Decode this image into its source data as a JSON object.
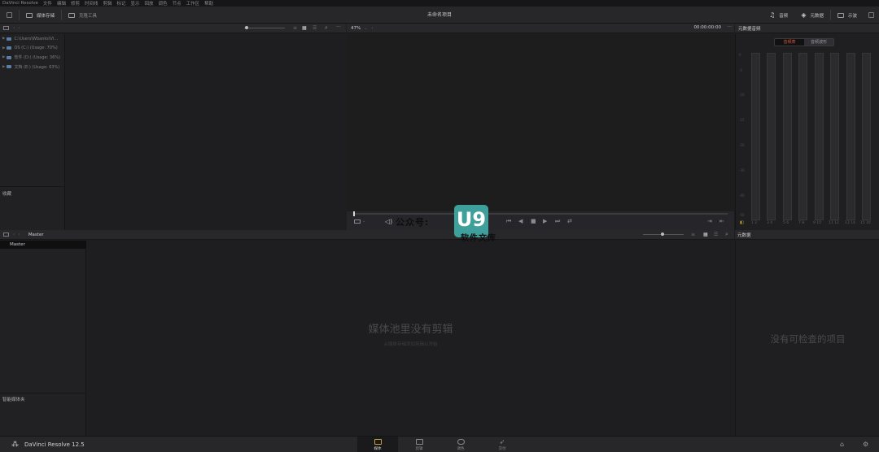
{
  "menubar": {
    "items": [
      "DaVinci Resolve",
      "文件",
      "编辑",
      "修剪",
      "时间线",
      "剪辑",
      "标记",
      "显示",
      "回放",
      "调色",
      "节点",
      "工作区",
      "帮助"
    ]
  },
  "toolbar": {
    "media_storage": "媒体存储",
    "clone_tool": "克隆工具",
    "project_title": "未命名项目",
    "audio": "音频",
    "metadata": "元数据",
    "inspector": "示波"
  },
  "media_storage": {
    "drives": [
      "C:\\Users\\Wbanks\\Vi...",
      "OS (C:) (Usage: 70%)",
      "软件 (D:) (Usage: 36%)",
      "文档 (E:) (Usage: 63%)"
    ],
    "favorites_label": "收藏"
  },
  "viewer": {
    "zoom": "47%",
    "timecode": "00:00:00:00"
  },
  "audio_meter": {
    "title": "元数据音频",
    "seg_active": "音频表",
    "seg_other": "音频波形",
    "channels": [
      "1",
      "2",
      "3",
      "4",
      "5",
      "6",
      "7",
      "8",
      "9",
      "10",
      "11",
      "12",
      "13",
      "14",
      "15",
      "16"
    ],
    "channel_pairs": [
      "1  2",
      "3  4",
      "5  6",
      "7  8",
      "9  10",
      "11  12",
      "13  14",
      "15  16"
    ],
    "db_marks": [
      "0",
      "-5",
      "-10",
      "-15",
      "-20",
      "-30",
      "-40",
      "-50"
    ]
  },
  "media_pool": {
    "header_label": "Master",
    "master_bin": "Master",
    "smart_bins_label": "智能媒体夹",
    "empty_title": "媒体池里没有剪辑",
    "empty_subtitle": "从媒体存储添加剪辑以开始"
  },
  "inspector_panel": {
    "title": "元数据",
    "empty_text": "没有可检查的项目"
  },
  "pagebar": {
    "app_name": "DaVinci Resolve 12.5",
    "pages": [
      "媒体",
      "剪辑",
      "调色",
      "交付"
    ]
  },
  "watermark": {
    "text": "公众号:",
    "logo": "U9",
    "sub": "软件文库"
  }
}
